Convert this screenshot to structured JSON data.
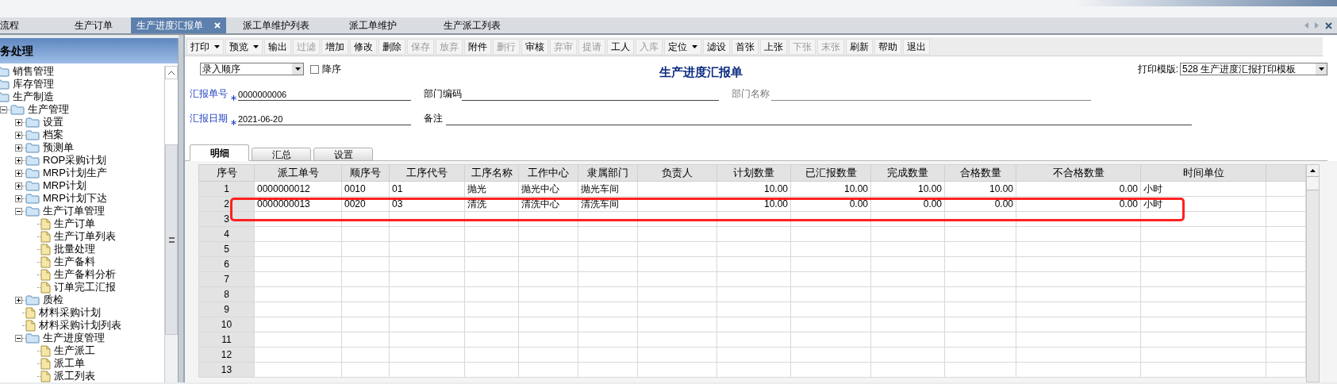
{
  "tabs": [
    {
      "label": "流程",
      "selected": false
    },
    {
      "label": "生产订单",
      "selected": false
    },
    {
      "label": "生产进度汇报单",
      "selected": true
    },
    {
      "label": "派工单维护列表",
      "selected": false
    },
    {
      "label": "派工单维护",
      "selected": false
    },
    {
      "label": "生产派工列表",
      "selected": false
    }
  ],
  "sidebar": {
    "title": "务处理",
    "items": [
      {
        "label": "销售管理",
        "kind": "folder",
        "expanded": false
      },
      {
        "label": "库存管理",
        "kind": "folder",
        "expanded": false
      },
      {
        "label": "生产制造",
        "kind": "folder",
        "expanded": true,
        "children": [
          {
            "label": "生产管理",
            "kind": "folder",
            "expanded": true,
            "children": [
              {
                "label": "设置",
                "kind": "folder",
                "expanded": false
              },
              {
                "label": "档案",
                "kind": "folder",
                "expanded": false
              },
              {
                "label": "预测单",
                "kind": "folder",
                "expanded": false
              },
              {
                "label": "ROP采购计划",
                "kind": "folder",
                "expanded": false
              },
              {
                "label": "MRP计划生产",
                "kind": "folder",
                "expanded": false
              },
              {
                "label": "MRP计划",
                "kind": "folder",
                "expanded": false
              },
              {
                "label": "MRP计划下达",
                "kind": "folder",
                "expanded": false
              },
              {
                "label": "生产订单管理",
                "kind": "folder",
                "expanded": true,
                "children": [
                  {
                    "label": "生产订单",
                    "kind": "document"
                  },
                  {
                    "label": "生产订单列表",
                    "kind": "document"
                  },
                  {
                    "label": "批量处理",
                    "kind": "document"
                  },
                  {
                    "label": "生产备料",
                    "kind": "document"
                  },
                  {
                    "label": "生产备料分析",
                    "kind": "document"
                  },
                  {
                    "label": "订单完工汇报",
                    "kind": "document"
                  }
                ]
              },
              {
                "label": "质检",
                "kind": "folder",
                "expanded": false
              },
              {
                "label": "材料采购计划",
                "kind": "document"
              },
              {
                "label": "材料采购计划列表",
                "kind": "document"
              },
              {
                "label": "生产进度管理",
                "kind": "folder",
                "expanded": true,
                "children": [
                  {
                    "label": "生产派工",
                    "kind": "document"
                  },
                  {
                    "label": "派工单",
                    "kind": "document"
                  },
                  {
                    "label": "派工列表",
                    "kind": "document"
                  }
                ]
              }
            ]
          }
        ]
      }
    ]
  },
  "toolbar": [
    {
      "label": "打印",
      "kind": "menu",
      "disabled": false
    },
    {
      "label": "预览",
      "kind": "menu",
      "disabled": false
    },
    {
      "label": "输出",
      "kind": "button",
      "disabled": false
    },
    {
      "label": "过滤",
      "kind": "button",
      "disabled": true
    },
    {
      "label": "增加",
      "kind": "button",
      "disabled": false
    },
    {
      "label": "修改",
      "kind": "button",
      "disabled": false
    },
    {
      "label": "删除",
      "kind": "button",
      "disabled": false
    },
    {
      "label": "保存",
      "kind": "button",
      "disabled": true
    },
    {
      "label": "放弃",
      "kind": "button",
      "disabled": true
    },
    {
      "label": "附件",
      "kind": "button",
      "disabled": false
    },
    {
      "label": "删行",
      "kind": "button",
      "disabled": true
    },
    {
      "label": "审核",
      "kind": "button",
      "disabled": false
    },
    {
      "label": "弃审",
      "kind": "button",
      "disabled": true
    },
    {
      "label": "提请",
      "kind": "button",
      "disabled": true
    },
    {
      "label": "工人",
      "kind": "button",
      "disabled": false
    },
    {
      "label": "入库",
      "kind": "button",
      "disabled": true
    },
    {
      "label": "定位",
      "kind": "menu",
      "disabled": false
    },
    {
      "label": "滤设",
      "kind": "button",
      "disabled": false
    },
    {
      "label": "首张",
      "kind": "button",
      "disabled": false
    },
    {
      "label": "上张",
      "kind": "button",
      "disabled": false
    },
    {
      "label": "下张",
      "kind": "button",
      "disabled": true
    },
    {
      "label": "末张",
      "kind": "button",
      "disabled": true
    },
    {
      "label": "刷新",
      "kind": "button",
      "disabled": false
    },
    {
      "label": "帮助",
      "kind": "button",
      "disabled": false
    },
    {
      "label": "退出",
      "kind": "button",
      "disabled": false
    }
  ],
  "sort": {
    "value": "录入顺序",
    "descending_label": "降序",
    "descending": false
  },
  "form_title": "生产进度汇报单",
  "print_template": {
    "label": "打印模版:",
    "value": "528 生产进度汇报打印模板"
  },
  "form_rows": [
    [
      {
        "label": "汇报单号",
        "required": true,
        "disabled": false,
        "value": "0000000006"
      },
      {
        "label": "部门编码",
        "required": false,
        "disabled": false
      },
      {
        "label": "部门名称",
        "required": false,
        "disabled": true
      }
    ],
    [
      {
        "label": "汇报日期",
        "required": true,
        "disabled": false,
        "value": "2021-06-20"
      },
      {
        "label": "备注",
        "required": false,
        "disabled": false
      }
    ]
  ],
  "detail_tabs": [
    {
      "label": "明细",
      "selected": true
    },
    {
      "label": "汇总",
      "selected": false
    },
    {
      "label": "设置",
      "selected": false
    }
  ],
  "table": {
    "columns": [
      {
        "label": "序号",
        "kind": "index"
      },
      {
        "label": "派工单号",
        "kind": "text"
      },
      {
        "label": "顺序号",
        "kind": "text"
      },
      {
        "label": "工序代号",
        "kind": "text"
      },
      {
        "label": "工序名称",
        "kind": "text"
      },
      {
        "label": "工作中心",
        "kind": "text"
      },
      {
        "label": "隶属部门",
        "kind": "text"
      },
      {
        "label": "负责人",
        "kind": "text"
      },
      {
        "label": "计划数量",
        "kind": "number"
      },
      {
        "label": "已汇报数量",
        "kind": "number"
      },
      {
        "label": "完成数量",
        "kind": "number"
      },
      {
        "label": "合格数量",
        "kind": "number"
      },
      {
        "label": "不合格数量",
        "kind": "number"
      },
      {
        "label": "时间单位",
        "kind": "text"
      }
    ],
    "rows": [
      {
        "highlighted": false,
        "cells": [
          "1",
          "0000000012",
          "0010",
          "01",
          "抛光",
          "抛光中心",
          "抛光车间",
          "",
          "10.00",
          "10.00",
          "10.00",
          "10.00",
          "0.00",
          "小时"
        ]
      },
      {
        "highlighted": true,
        "cells": [
          "2",
          "0000000013",
          "0020",
          "03",
          "清洗",
          "清洗中心",
          "清洗车间",
          "",
          "10.00",
          "0.00",
          "0.00",
          "0.00",
          "0.00",
          "小时"
        ]
      },
      {
        "highlighted": false,
        "cells": [
          "3"
        ]
      },
      {
        "highlighted": false,
        "cells": [
          "4"
        ]
      },
      {
        "highlighted": false,
        "cells": [
          "5"
        ]
      },
      {
        "highlighted": false,
        "cells": [
          "6"
        ]
      },
      {
        "highlighted": false,
        "cells": [
          "7"
        ]
      },
      {
        "highlighted": false,
        "cells": [
          "8"
        ]
      },
      {
        "highlighted": false,
        "cells": [
          "9"
        ]
      },
      {
        "highlighted": false,
        "cells": [
          "10"
        ]
      },
      {
        "highlighted": false,
        "cells": [
          "11"
        ]
      },
      {
        "highlighted": false,
        "cells": [
          "12"
        ]
      },
      {
        "highlighted": false,
        "cells": [
          "13"
        ]
      }
    ]
  }
}
